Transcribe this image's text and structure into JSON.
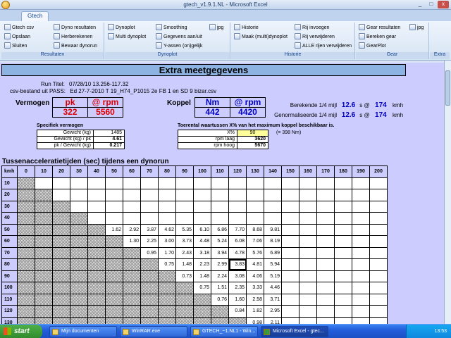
{
  "window": {
    "title": "gtech_v1.9.1.NL - Microsoft Excel",
    "min": "_",
    "max": "□",
    "close": "x"
  },
  "ribbon": {
    "tab": "Gtech",
    "groups": [
      {
        "label": "Resultaten",
        "items": [
          "Gtech csv",
          "Opslaan",
          "Sluiten",
          "Dyno resultaten",
          "Herberekenen",
          "Bewaar dynorun"
        ]
      },
      {
        "label": "Dynoplot",
        "items": [
          "Dynoplot",
          "Multi dynoplot",
          "Smoothing",
          "Gegevens aan/uit",
          "Y-assen (on)gelijk",
          "jpg"
        ]
      },
      {
        "label": "Historie",
        "items": [
          "Historie",
          "Maak (multi)dynoplot",
          "Rij invoegen",
          "Rij verwijderen",
          "ALLE rijen verwijderen"
        ]
      },
      {
        "label": "Gear",
        "items": [
          "Gear resultaten",
          "Bereken gear",
          "GearPlot",
          "jpg"
        ]
      },
      {
        "label": "Extra",
        "items": []
      }
    ]
  },
  "sheet": {
    "banner": "Extra meetgegevens",
    "run_title_label": "Run Titel:",
    "run_title_value": "07/28/10 13.256-117.32",
    "csv_label": "csv-bestand uit PASS:",
    "csv_value": "Ed 27-7-2010 T 19_H74_P1015 2e FB 1 en SD 9 bizar.csv",
    "vermogen": {
      "label": "Vermogen",
      "h1": "pk",
      "h2": "@ rpm",
      "v1": "322",
      "v2": "5560"
    },
    "koppel": {
      "label": "Koppel",
      "h1": "Nm",
      "h2": "@ rpm",
      "v1": "442",
      "v2": "4420"
    },
    "mijl": [
      {
        "label": "Berekende 1/4 mijl",
        "s": "12.6",
        "s_unit": "s @",
        "kmh": "174",
        "kmh_unit": "kmh"
      },
      {
        "label": "Genormaliseerde 1/4 mijl",
        "s": "12.6",
        "s_unit": "s @",
        "kmh": "174",
        "kmh_unit": "kmh"
      }
    ],
    "specifiek": {
      "title": "Specifiek vermogen",
      "rows": [
        {
          "k": "Gewicht (kg)",
          "v": "1485"
        },
        {
          "k": "Gewicht (kg) / pk",
          "v": "4.61"
        },
        {
          "k": "pk / Gewicht (kg)",
          "v": "0.217"
        }
      ]
    },
    "toerental": {
      "title": "Toerental waartussen X% van het maximum koppel beschikbaar is.",
      "rows": [
        {
          "k": "X%",
          "v": "90",
          "note": "(= 398 Nm)"
        },
        {
          "k": "rpm laag",
          "v": "3620",
          "note": ""
        },
        {
          "k": "rpm hoog",
          "v": "5670",
          "note": ""
        }
      ]
    },
    "grid": {
      "title": "Tussenacceleratietijden (sec) tijdens een dynorun",
      "corner": "kmh",
      "cols": [
        "0",
        "10",
        "20",
        "30",
        "40",
        "50",
        "60",
        "70",
        "80",
        "90",
        "100",
        "110",
        "120",
        "130",
        "140",
        "150",
        "160",
        "170",
        "180",
        "190",
        "200"
      ],
      "rows": [
        {
          "kmh": "10",
          "hatch": 1,
          "vals": []
        },
        {
          "kmh": "20",
          "hatch": 2,
          "vals": []
        },
        {
          "kmh": "30",
          "hatch": 3,
          "vals": []
        },
        {
          "kmh": "40",
          "hatch": 4,
          "vals": []
        },
        {
          "kmh": "50",
          "hatch": 5,
          "vals": [
            "1.62",
            "2.92",
            "3.87",
            "4.62",
            "5.35",
            "6.10",
            "6.86",
            "7.70",
            "8.68",
            "9.81"
          ]
        },
        {
          "kmh": "60",
          "hatch": 6,
          "vals": [
            "1.30",
            "2.25",
            "3.00",
            "3.73",
            "4.48",
            "5.24",
            "6.08",
            "7.06",
            "8.19"
          ]
        },
        {
          "kmh": "70",
          "hatch": 7,
          "vals": [
            "0.95",
            "1.70",
            "2.43",
            "3.18",
            "3.94",
            "4.78",
            "5.76",
            "6.89"
          ]
        },
        {
          "kmh": "80",
          "hatch": 8,
          "vals": [
            "0.75",
            "1.48",
            "2.23",
            "2.99",
            "3.83",
            "4.81",
            "5.94"
          ]
        },
        {
          "kmh": "90",
          "hatch": 9,
          "vals": [
            "0.73",
            "1.48",
            "2.24",
            "3.08",
            "4.06",
            "5.19"
          ]
        },
        {
          "kmh": "100",
          "hatch": 10,
          "vals": [
            "0.75",
            "1.51",
            "2.35",
            "3.33",
            "4.46"
          ]
        },
        {
          "kmh": "110",
          "hatch": 11,
          "vals": [
            "0.76",
            "1.60",
            "2.58",
            "3.71"
          ]
        },
        {
          "kmh": "120",
          "hatch": 12,
          "vals": [
            "0.84",
            "1.82",
            "2.95"
          ]
        },
        {
          "kmh": "130",
          "hatch": 13,
          "vals": [
            "0.98",
            "2.11"
          ]
        }
      ],
      "selected": {
        "row": 7,
        "col": 12
      }
    }
  },
  "taskbar": {
    "start": "start",
    "buttons": [
      "Mijn documenten",
      "WinRAR.exe",
      "GTECH_~1.NL1 - Win...",
      "Microsoft Excel - gtec..."
    ],
    "active": 3,
    "clock": "13:53"
  }
}
